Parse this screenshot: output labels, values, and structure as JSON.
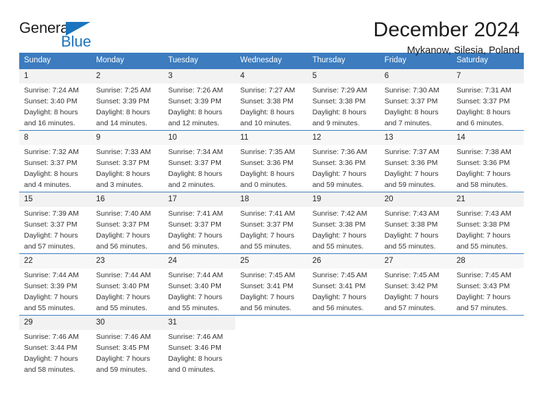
{
  "logo": {
    "word_top": "General",
    "word_bottom": "Blue",
    "triangle_color": "#1b74bd"
  },
  "header": {
    "title": "December 2024",
    "subtitle": "Mykanow, Silesia, Poland"
  },
  "theme": {
    "header_row_bg": "#3c7cbf",
    "header_row_text": "#ffffff",
    "daynum_band_bg": "#f2f2f2",
    "row_divider": "#3c7cbf"
  },
  "weekday_headers": [
    "Sunday",
    "Monday",
    "Tuesday",
    "Wednesday",
    "Thursday",
    "Friday",
    "Saturday"
  ],
  "weeks": [
    [
      {
        "day": "1",
        "sunrise": "Sunrise: 7:24 AM",
        "sunset": "Sunset: 3:40 PM",
        "daylight_line1": "Daylight: 8 hours",
        "daylight_line2": "and 16 minutes."
      },
      {
        "day": "2",
        "sunrise": "Sunrise: 7:25 AM",
        "sunset": "Sunset: 3:39 PM",
        "daylight_line1": "Daylight: 8 hours",
        "daylight_line2": "and 14 minutes."
      },
      {
        "day": "3",
        "sunrise": "Sunrise: 7:26 AM",
        "sunset": "Sunset: 3:39 PM",
        "daylight_line1": "Daylight: 8 hours",
        "daylight_line2": "and 12 minutes."
      },
      {
        "day": "4",
        "sunrise": "Sunrise: 7:27 AM",
        "sunset": "Sunset: 3:38 PM",
        "daylight_line1": "Daylight: 8 hours",
        "daylight_line2": "and 10 minutes."
      },
      {
        "day": "5",
        "sunrise": "Sunrise: 7:29 AM",
        "sunset": "Sunset: 3:38 PM",
        "daylight_line1": "Daylight: 8 hours",
        "daylight_line2": "and 9 minutes."
      },
      {
        "day": "6",
        "sunrise": "Sunrise: 7:30 AM",
        "sunset": "Sunset: 3:37 PM",
        "daylight_line1": "Daylight: 8 hours",
        "daylight_line2": "and 7 minutes."
      },
      {
        "day": "7",
        "sunrise": "Sunrise: 7:31 AM",
        "sunset": "Sunset: 3:37 PM",
        "daylight_line1": "Daylight: 8 hours",
        "daylight_line2": "and 6 minutes."
      }
    ],
    [
      {
        "day": "8",
        "sunrise": "Sunrise: 7:32 AM",
        "sunset": "Sunset: 3:37 PM",
        "daylight_line1": "Daylight: 8 hours",
        "daylight_line2": "and 4 minutes."
      },
      {
        "day": "9",
        "sunrise": "Sunrise: 7:33 AM",
        "sunset": "Sunset: 3:37 PM",
        "daylight_line1": "Daylight: 8 hours",
        "daylight_line2": "and 3 minutes."
      },
      {
        "day": "10",
        "sunrise": "Sunrise: 7:34 AM",
        "sunset": "Sunset: 3:37 PM",
        "daylight_line1": "Daylight: 8 hours",
        "daylight_line2": "and 2 minutes."
      },
      {
        "day": "11",
        "sunrise": "Sunrise: 7:35 AM",
        "sunset": "Sunset: 3:36 PM",
        "daylight_line1": "Daylight: 8 hours",
        "daylight_line2": "and 0 minutes."
      },
      {
        "day": "12",
        "sunrise": "Sunrise: 7:36 AM",
        "sunset": "Sunset: 3:36 PM",
        "daylight_line1": "Daylight: 7 hours",
        "daylight_line2": "and 59 minutes."
      },
      {
        "day": "13",
        "sunrise": "Sunrise: 7:37 AM",
        "sunset": "Sunset: 3:36 PM",
        "daylight_line1": "Daylight: 7 hours",
        "daylight_line2": "and 59 minutes."
      },
      {
        "day": "14",
        "sunrise": "Sunrise: 7:38 AM",
        "sunset": "Sunset: 3:36 PM",
        "daylight_line1": "Daylight: 7 hours",
        "daylight_line2": "and 58 minutes."
      }
    ],
    [
      {
        "day": "15",
        "sunrise": "Sunrise: 7:39 AM",
        "sunset": "Sunset: 3:37 PM",
        "daylight_line1": "Daylight: 7 hours",
        "daylight_line2": "and 57 minutes."
      },
      {
        "day": "16",
        "sunrise": "Sunrise: 7:40 AM",
        "sunset": "Sunset: 3:37 PM",
        "daylight_line1": "Daylight: 7 hours",
        "daylight_line2": "and 56 minutes."
      },
      {
        "day": "17",
        "sunrise": "Sunrise: 7:41 AM",
        "sunset": "Sunset: 3:37 PM",
        "daylight_line1": "Daylight: 7 hours",
        "daylight_line2": "and 56 minutes."
      },
      {
        "day": "18",
        "sunrise": "Sunrise: 7:41 AM",
        "sunset": "Sunset: 3:37 PM",
        "daylight_line1": "Daylight: 7 hours",
        "daylight_line2": "and 55 minutes."
      },
      {
        "day": "19",
        "sunrise": "Sunrise: 7:42 AM",
        "sunset": "Sunset: 3:38 PM",
        "daylight_line1": "Daylight: 7 hours",
        "daylight_line2": "and 55 minutes."
      },
      {
        "day": "20",
        "sunrise": "Sunrise: 7:43 AM",
        "sunset": "Sunset: 3:38 PM",
        "daylight_line1": "Daylight: 7 hours",
        "daylight_line2": "and 55 minutes."
      },
      {
        "day": "21",
        "sunrise": "Sunrise: 7:43 AM",
        "sunset": "Sunset: 3:38 PM",
        "daylight_line1": "Daylight: 7 hours",
        "daylight_line2": "and 55 minutes."
      }
    ],
    [
      {
        "day": "22",
        "sunrise": "Sunrise: 7:44 AM",
        "sunset": "Sunset: 3:39 PM",
        "daylight_line1": "Daylight: 7 hours",
        "daylight_line2": "and 55 minutes."
      },
      {
        "day": "23",
        "sunrise": "Sunrise: 7:44 AM",
        "sunset": "Sunset: 3:40 PM",
        "daylight_line1": "Daylight: 7 hours",
        "daylight_line2": "and 55 minutes."
      },
      {
        "day": "24",
        "sunrise": "Sunrise: 7:44 AM",
        "sunset": "Sunset: 3:40 PM",
        "daylight_line1": "Daylight: 7 hours",
        "daylight_line2": "and 55 minutes."
      },
      {
        "day": "25",
        "sunrise": "Sunrise: 7:45 AM",
        "sunset": "Sunset: 3:41 PM",
        "daylight_line1": "Daylight: 7 hours",
        "daylight_line2": "and 56 minutes."
      },
      {
        "day": "26",
        "sunrise": "Sunrise: 7:45 AM",
        "sunset": "Sunset: 3:41 PM",
        "daylight_line1": "Daylight: 7 hours",
        "daylight_line2": "and 56 minutes."
      },
      {
        "day": "27",
        "sunrise": "Sunrise: 7:45 AM",
        "sunset": "Sunset: 3:42 PM",
        "daylight_line1": "Daylight: 7 hours",
        "daylight_line2": "and 57 minutes."
      },
      {
        "day": "28",
        "sunrise": "Sunrise: 7:45 AM",
        "sunset": "Sunset: 3:43 PM",
        "daylight_line1": "Daylight: 7 hours",
        "daylight_line2": "and 57 minutes."
      }
    ],
    [
      {
        "day": "29",
        "sunrise": "Sunrise: 7:46 AM",
        "sunset": "Sunset: 3:44 PM",
        "daylight_line1": "Daylight: 7 hours",
        "daylight_line2": "and 58 minutes."
      },
      {
        "day": "30",
        "sunrise": "Sunrise: 7:46 AM",
        "sunset": "Sunset: 3:45 PM",
        "daylight_line1": "Daylight: 7 hours",
        "daylight_line2": "and 59 minutes."
      },
      {
        "day": "31",
        "sunrise": "Sunrise: 7:46 AM",
        "sunset": "Sunset: 3:46 PM",
        "daylight_line1": "Daylight: 8 hours",
        "daylight_line2": "and 0 minutes."
      },
      {
        "day": "",
        "sunrise": "",
        "sunset": "",
        "daylight_line1": "",
        "daylight_line2": ""
      },
      {
        "day": "",
        "sunrise": "",
        "sunset": "",
        "daylight_line1": "",
        "daylight_line2": ""
      },
      {
        "day": "",
        "sunrise": "",
        "sunset": "",
        "daylight_line1": "",
        "daylight_line2": ""
      },
      {
        "day": "",
        "sunrise": "",
        "sunset": "",
        "daylight_line1": "",
        "daylight_line2": ""
      }
    ]
  ]
}
